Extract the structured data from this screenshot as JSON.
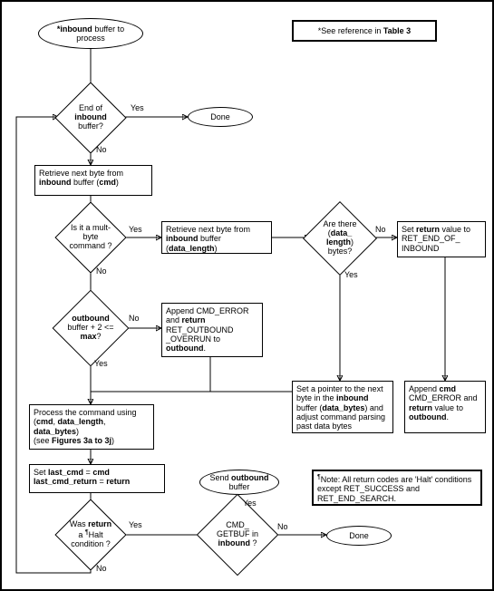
{
  "ref_note": "*See reference in ",
  "ref_note_bold": "Table 3",
  "footnote_pre": "¶Note: All return codes are 'Halt' conditions except RET_SUCCESS and RET_END_SEARCH.",
  "start": "*inbound buffer to process",
  "d_end_inbound": "End of inbound buffer?",
  "done": "Done",
  "retrieve_cmd": "Retrieve next byte from inbound buffer (cmd)",
  "d_multibyte": "Is it a mult-byte command?",
  "retrieve_len": "Retrieve next byte from inbound buffer (data_length)",
  "d_bytes_avail": "Are there (data_length) bytes?",
  "set_ret_end": "Set return value to RET_END_OF_INBOUND",
  "d_outbound_room": "outbound buffer + 2 <= max?",
  "append_err": "Append CMD_ERROR and return RET_OUTBOUND_OVERRUN to outbound.",
  "set_ptr": "Set a pointer to the next byte in the inbound buffer (data_bytes) and adjust command parsing past data bytes",
  "append_cmd_err": "Append cmd CMD_ERROR and return value to outbound.",
  "process_cmd": "Process the command using (cmd, data_length, data_bytes)\n(see Figures 3a to 3j)",
  "set_last": "Set last_cmd = cmd\nlast_cmd_return = return",
  "send_outbound": "Send outbound buffer",
  "d_halt": "Was return a ¶Halt condition?",
  "d_getbuf": "CMD_GETBUF in inbound?",
  "yes": "Yes",
  "no": "No"
}
